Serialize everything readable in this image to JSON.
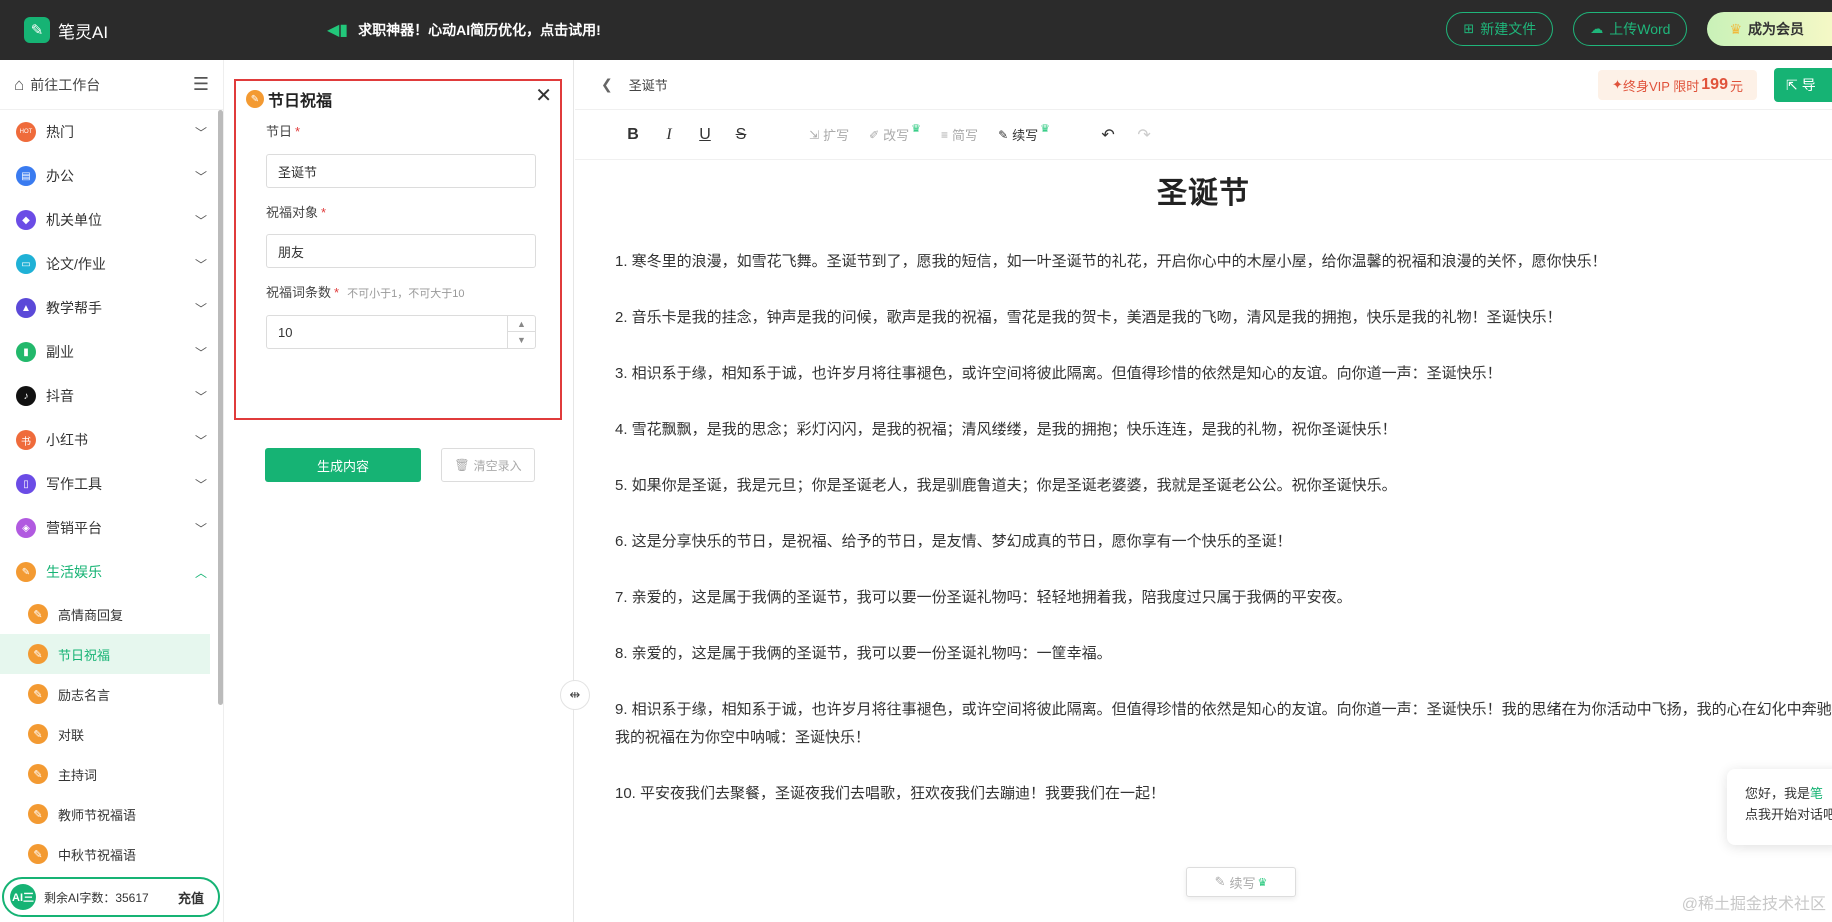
{
  "topbar": {
    "logo_mark": "✎",
    "logo_text": "笔灵AI",
    "promo_icon": "megaphone-icon",
    "promo_text": "求职神器！心动AI简历优化，点击试用!",
    "new_file_label": "新建文件",
    "upload_label": "上传Word",
    "vip_label": "成为会员"
  },
  "sidebar": {
    "header_label": "前往工作台",
    "items": [
      {
        "label": "热门",
        "icon": "hot-icon",
        "color": "#ef6b3b",
        "glyph": "HOT"
      },
      {
        "label": "办公",
        "icon": "briefcase-icon",
        "color": "#3a7bf0",
        "glyph": "▤"
      },
      {
        "label": "机关单位",
        "icon": "government-icon",
        "color": "#6b4ce6",
        "glyph": "◆"
      },
      {
        "label": "论文/作业",
        "icon": "paper-icon",
        "color": "#1fb1d6",
        "glyph": "▭"
      },
      {
        "label": "教学帮手",
        "icon": "graduation-cap-icon",
        "color": "#5b49d8",
        "glyph": "▲"
      },
      {
        "label": "副业",
        "icon": "bottle-icon",
        "color": "#22b86b",
        "glyph": "▮"
      },
      {
        "label": "抖音",
        "icon": "tiktok-icon",
        "color": "#111111",
        "glyph": "♪"
      },
      {
        "label": "小红书",
        "icon": "xiaohongshu-icon",
        "color": "#ef6b3b",
        "glyph": "书"
      },
      {
        "label": "写作工具",
        "icon": "book-icon",
        "color": "#6b4ce6",
        "glyph": "▯"
      },
      {
        "label": "营销平台",
        "icon": "tag-icon",
        "color": "#b15ae0",
        "glyph": "◈"
      },
      {
        "label": "生活娱乐",
        "icon": "life-icon",
        "color": "#f39a32",
        "glyph": "✎"
      }
    ],
    "sub_items": [
      {
        "label": "高情商回复"
      },
      {
        "label": "节日祝福"
      },
      {
        "label": "励志名言"
      },
      {
        "label": "对联"
      },
      {
        "label": "主持词"
      },
      {
        "label": "教师节祝福语"
      },
      {
        "label": "中秋节祝福语"
      }
    ],
    "quota_badge": "AI三",
    "quota_text": "剩余AI字数：35617",
    "recharge_label": "充值"
  },
  "form": {
    "title": "节日祝福",
    "festival_label": "节日",
    "festival_value": "圣诞节",
    "target_label": "祝福对象",
    "target_value": "朋友",
    "count_label": "祝福词条数",
    "count_hint": "不可小于1，不可大于10",
    "count_value": "10",
    "required_mark": "*",
    "generate_label": "生成内容",
    "clear_label": "清空录入"
  },
  "editor": {
    "doc_title": "圣诞节",
    "vip_prefix": "终身VIP 限时",
    "vip_price": "199",
    "vip_unit": "元",
    "export_label": "导",
    "tools": {
      "expand": "扩写",
      "rewrite": "改写",
      "simplify": "简写",
      "continue": "续写"
    },
    "heading": "圣诞节",
    "paragraphs": [
      "1. 寒冬里的浪漫，如雪花飞舞。圣诞节到了，愿我的短信，如一叶圣诞节的礼花，开启你心中的木屋小屋，给你温馨的祝福和浪漫的关怀，愿你快乐！",
      "2. 音乐卡是我的挂念，钟声是我的问候，歌声是我的祝福，雪花是我的贺卡，美酒是我的飞吻，清风是我的拥抱，快乐是我的礼物！圣诞快乐！",
      "3. 相识系于缘，相知系于诚，也许岁月将往事褪色，或许空间将彼此隔离。但值得珍惜的依然是知心的友谊。向你道一声：圣诞快乐！",
      "4. 雪花飘飘，是我的思念；彩灯闪闪，是我的祝福；清风缕缕，是我的拥抱；快乐连连，是我的礼物，祝你圣诞快乐！",
      "5. 如果你是圣诞，我是元旦；你是圣诞老人，我是驯鹿鲁道夫；你是圣诞老婆婆，我就是圣诞老公公。祝你圣诞快乐。",
      "6. 这是分享快乐的节日，是祝福、给予的节日，是友情、梦幻成真的节日，愿你享有一个快乐的圣诞！",
      "7. 亲爱的，这是属于我俩的圣诞节，我可以要一份圣诞礼物吗：轻轻地拥着我，陪我度过只属于我俩的平安夜。",
      "8. 亲爱的，这是属于我俩的圣诞节，我可以要一份圣诞礼物吗：一筐幸福。",
      "9. 相识系于缘，相知系于诚，也许岁月将往事褪色，或许空间将彼此隔离。但值得珍惜的依然是知心的友谊。向你道一声：圣诞快乐！我的思绪在为你活动中飞扬，我的心在幻化中奔驰，我的祝福在为你空中呐喊：圣诞快乐！",
      "10. 平安夜我们去聚餐，圣诞夜我们去唱歌，狂欢夜我们去蹦迪！我要我们在一起！"
    ],
    "float_continue_label": "续写",
    "chat_line1_prefix": "您好，我是",
    "chat_line1_brand": "笔",
    "chat_line2": "点我开始对话吧"
  },
  "watermark": "@稀土掘金技术社区",
  "colors": {
    "accent": "#16b374",
    "highlight_border": "#e03b3b",
    "topbar_bg": "#2b2b2b"
  }
}
